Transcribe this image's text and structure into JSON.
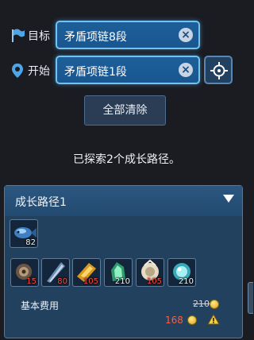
{
  "target": {
    "label": "目标",
    "value": "矛盾项链8段",
    "icon": "flag-icon",
    "clear_icon": "×"
  },
  "start": {
    "label": "开始",
    "value": "矛盾项链1段",
    "icon": "map-pin-icon",
    "clear_icon": "×",
    "locate_icon": "crosshair-icon"
  },
  "clear_all_label": "全部清除",
  "status_text": "已探索2个成长路径。",
  "path": {
    "title": "成长路径1",
    "collapse_icon": "triangle-down-icon",
    "base_item": {
      "icon": "fish-gem-icon",
      "count": "82"
    },
    "materials": [
      {
        "icon": "spiked-seed-icon",
        "count": "15"
      },
      {
        "icon": "blade-shard-icon",
        "count": "80"
      },
      {
        "icon": "gold-scroll-icon",
        "count": "105"
      },
      {
        "icon": "green-crystal-icon",
        "count": "210"
      },
      {
        "icon": "mystic-pouch-icon",
        "count": "105"
      },
      {
        "icon": "blue-orb-icon",
        "count": "210"
      }
    ],
    "cost_label": "基本费用",
    "cost_original": "210",
    "cost_discounted": "168",
    "warning_icon": "alert-icon"
  },
  "colors": {
    "field_border": "#6fc4f5",
    "panel_bg": "#22415f",
    "cost_red": "#ff5c3e"
  }
}
